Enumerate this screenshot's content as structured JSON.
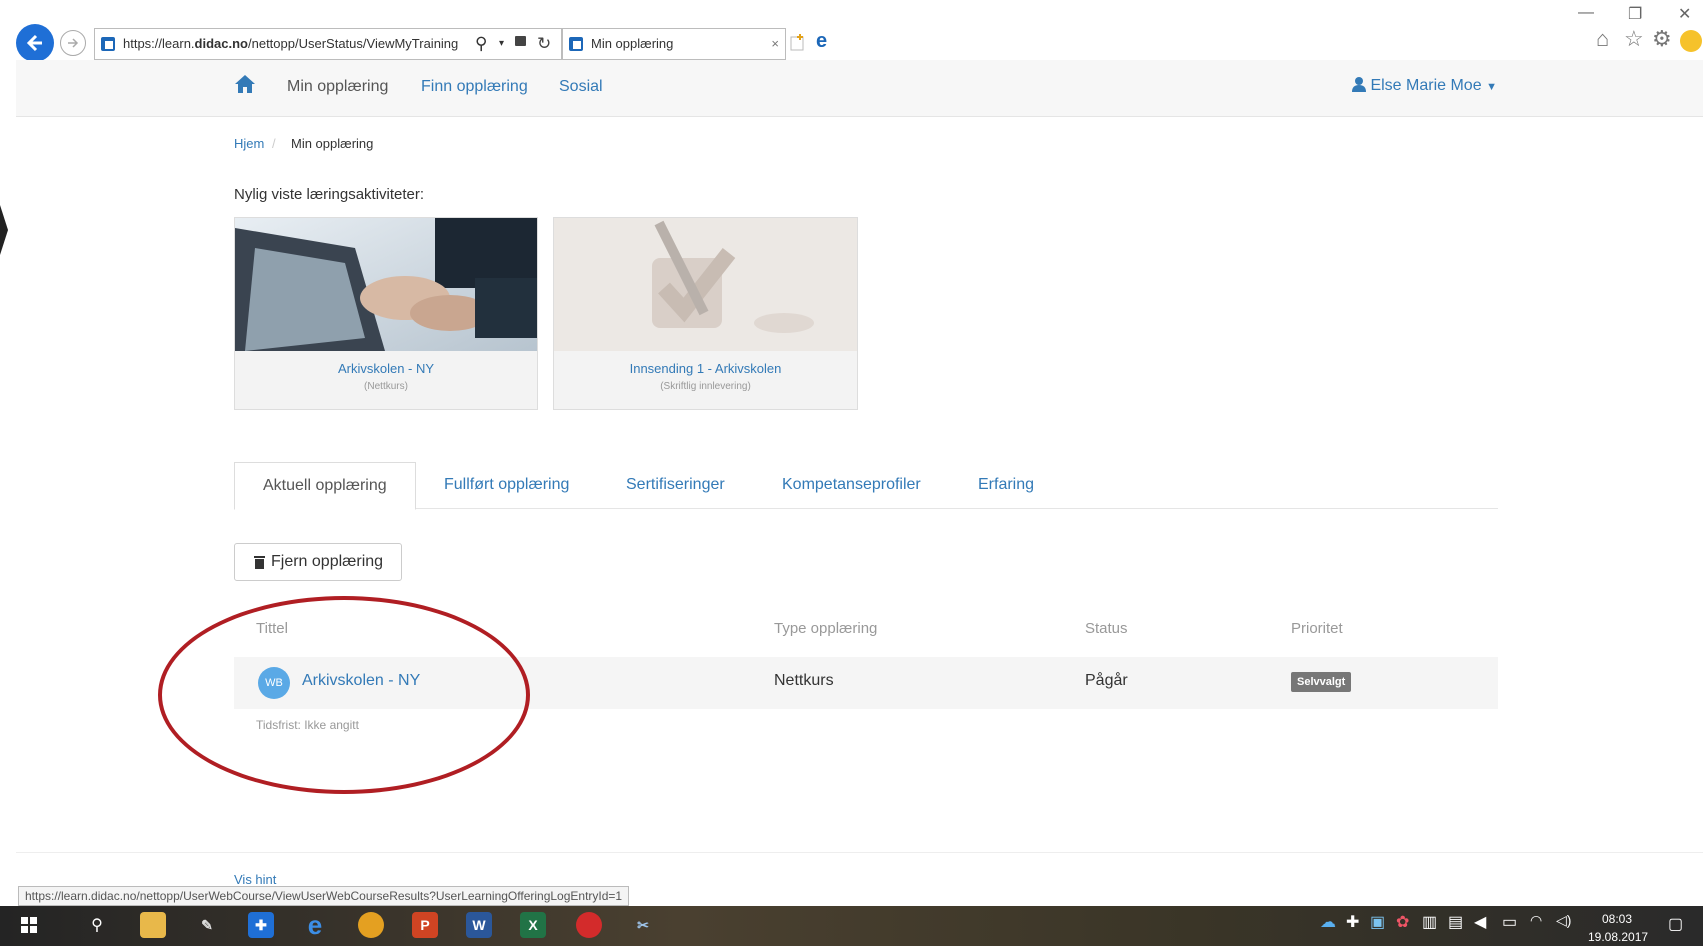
{
  "browser": {
    "url_prefix": "https://learn.",
    "url_domain": "didac.no",
    "url_path": "/nettopp/UserStatus/ViewMyTraining",
    "tab_title": "Min opplæring",
    "status_url": "https://learn.didac.no/nettopp/UserWebCourse/ViewUserWebCourseResults?UserLearningOfferingLogEntryId=1"
  },
  "nav": {
    "items": [
      {
        "label": "Min opplæring"
      },
      {
        "label": "Finn opplæring"
      },
      {
        "label": "Sosial"
      }
    ],
    "user": "Else Marie Moe"
  },
  "breadcrumb": {
    "home": "Hjem",
    "current": "Min opplæring"
  },
  "recent": {
    "title": "Nylig viste læringsaktiviteter:",
    "cards": [
      {
        "title": "Arkivskolen - NY",
        "subtitle": "(Nettkurs)"
      },
      {
        "title": "Innsending 1 - Arkivskolen",
        "subtitle": "(Skriftlig innlevering)"
      }
    ]
  },
  "tabs": [
    {
      "label": "Aktuell opplæring"
    },
    {
      "label": "Fullført opplæring"
    },
    {
      "label": "Sertifiseringer"
    },
    {
      "label": "Kompetanseprofiler"
    },
    {
      "label": "Erfaring"
    }
  ],
  "remove_button": "Fjern opplæring",
  "table": {
    "headers": [
      "Tittel",
      "Type opplæring",
      "Status",
      "Prioritet"
    ],
    "rows": [
      {
        "avatar": "WB",
        "title": "Arkivskolen - NY",
        "type": "Nettkurs",
        "status": "Pågår",
        "priority": "Selvvalgt",
        "deadline": "Tidsfrist: Ikke angitt"
      }
    ]
  },
  "footer": {
    "hint": "Vis hint"
  },
  "taskbar": {
    "time": "08:03",
    "date": "19.08.2017"
  },
  "colors": {
    "link": "#337ab7",
    "annotation": "#b01e23",
    "badge": "#777777"
  }
}
